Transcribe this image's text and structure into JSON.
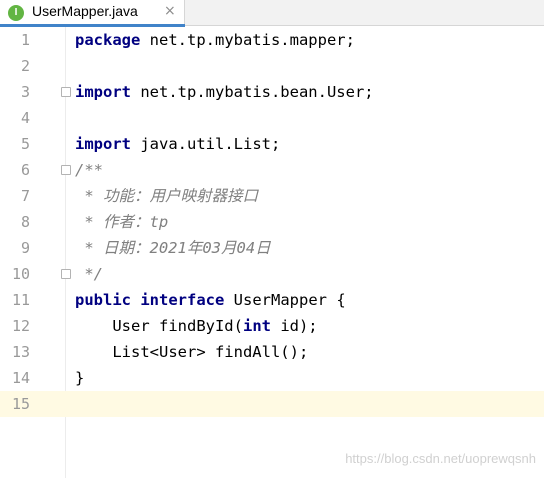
{
  "tab": {
    "icon_letter": "I",
    "title": "UserMapper.java",
    "close": "×"
  },
  "lines": [
    {
      "num": "1",
      "segs": [
        {
          "t": "package",
          "k": "kw"
        },
        {
          "t": " net.tp.mybatis.mapper;",
          "k": ""
        }
      ]
    },
    {
      "num": "2",
      "segs": []
    },
    {
      "num": "3",
      "fold": true,
      "segs": [
        {
          "t": "import",
          "k": "kw"
        },
        {
          "t": " net.tp.mybatis.bean.User;",
          "k": ""
        }
      ]
    },
    {
      "num": "4",
      "segs": []
    },
    {
      "num": "5",
      "segs": [
        {
          "t": "import",
          "k": "kw"
        },
        {
          "t": " java.util.List;",
          "k": ""
        }
      ]
    },
    {
      "num": "6",
      "fold": true,
      "segs": [
        {
          "t": "/**",
          "k": "cm"
        }
      ]
    },
    {
      "num": "7",
      "segs": [
        {
          "t": " * 功能：用户映射器接口",
          "k": "cm"
        }
      ]
    },
    {
      "num": "8",
      "segs": [
        {
          "t": " * 作者：tp",
          "k": "cm"
        }
      ]
    },
    {
      "num": "9",
      "segs": [
        {
          "t": " * 日期：2021年03月04日",
          "k": "cm"
        }
      ]
    },
    {
      "num": "10",
      "fold": true,
      "segs": [
        {
          "t": " */",
          "k": "cm"
        }
      ]
    },
    {
      "num": "11",
      "segs": [
        {
          "t": "public",
          "k": "kw"
        },
        {
          "t": " ",
          "k": ""
        },
        {
          "t": "interface",
          "k": "kw"
        },
        {
          "t": " UserMapper {",
          "k": ""
        }
      ]
    },
    {
      "num": "12",
      "segs": [
        {
          "t": "    User findById(",
          "k": ""
        },
        {
          "t": "int",
          "k": "kw"
        },
        {
          "t": " id);",
          "k": ""
        }
      ]
    },
    {
      "num": "13",
      "segs": [
        {
          "t": "    List<User> findAll();",
          "k": ""
        }
      ]
    },
    {
      "num": "14",
      "segs": [
        {
          "t": "}",
          "k": ""
        }
      ]
    },
    {
      "num": "15",
      "current": true,
      "segs": []
    }
  ],
  "watermark": "https://blog.csdn.net/uoprewqsnh",
  "colors": {
    "keyword": "#000080",
    "comment": "#808080",
    "current_line": "#fffae3",
    "tab_accent": "#4083c9",
    "interface_icon": "#62b543"
  }
}
